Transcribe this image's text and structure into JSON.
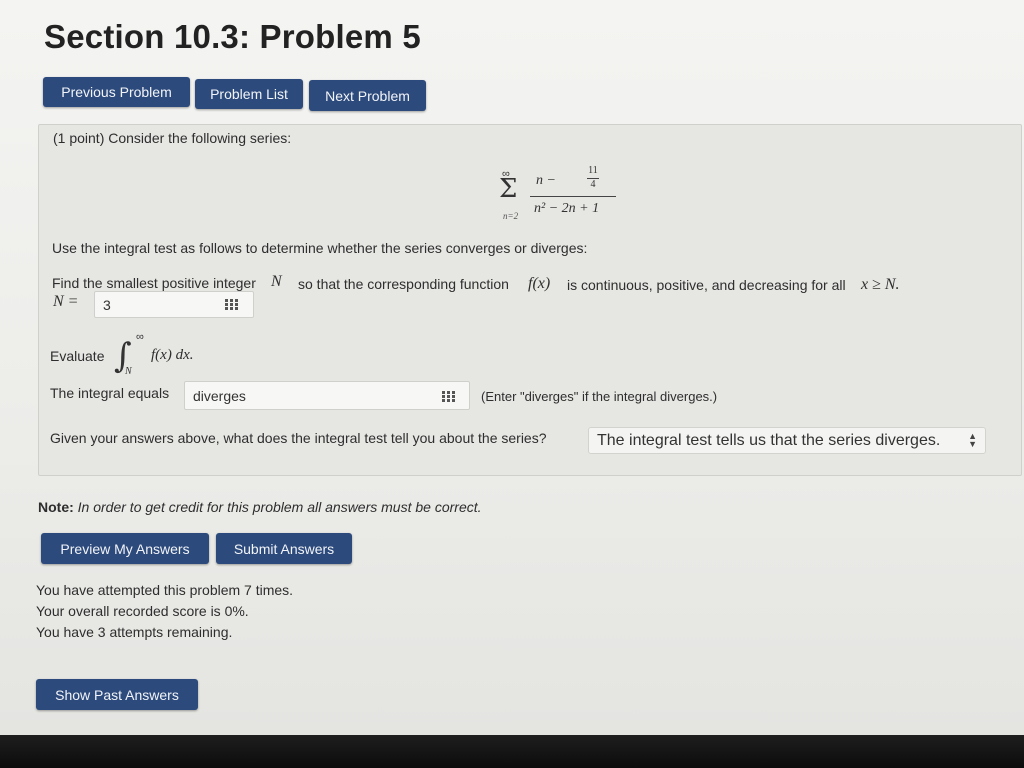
{
  "title": "Section 10.3: Problem 5",
  "nav": {
    "previous": "Previous Problem",
    "list": "Problem List",
    "next": "Next Problem"
  },
  "problem": {
    "intro": "(1 point) Consider the following series:",
    "series": {
      "sum_upper": "∞",
      "sum_lower": "n=2",
      "numerator": "n − ",
      "num_frac_top": "11",
      "num_frac_bottom": "4",
      "denominator": "n² − 2n + 1"
    },
    "instruction": "Use the integral test as follows to determine whether the series converges or diverges:",
    "find_text_1": "Find the smallest positive integer",
    "find_var": "N",
    "find_text_2": "so that the corresponding function",
    "find_func": "f(x)",
    "find_text_3": "is continuous, positive, and decreasing for all",
    "find_cond": "x ≥ N.",
    "n_label": "N =",
    "n_value": "3",
    "evaluate_label": "Evaluate",
    "integral_upper": "∞",
    "integral_lower": "N",
    "integrand": "f(x) dx.",
    "integral_label": "The integral equals",
    "integral_value": "diverges",
    "integral_hint": "(Enter \"diverges\" if the integral diverges.)",
    "question": "Given your answers above, what does the integral test tell you about the series?",
    "answer_selected": "The integral test tells us that the series diverges."
  },
  "note": {
    "bold": "Note:",
    "text": "In order to get credit for this problem all answers must be correct."
  },
  "actions": {
    "preview": "Preview My Answers",
    "submit": "Submit Answers",
    "show_past": "Show Past Answers"
  },
  "status": {
    "attempts": "You have attempted this problem 7 times.",
    "score": "Your overall recorded score is 0%.",
    "remaining": "You have 3 attempts remaining."
  }
}
